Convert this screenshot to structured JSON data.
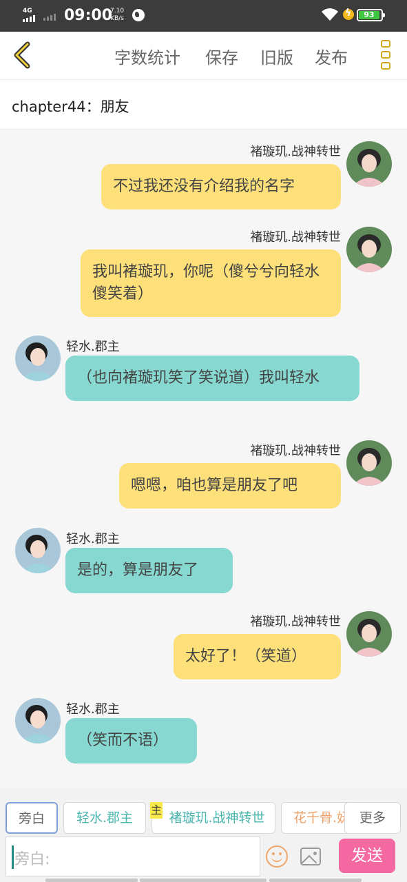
{
  "status": {
    "network": "4G",
    "time": "09:00",
    "speed_value": "7.10",
    "speed_unit": "KB/s",
    "battery": "93"
  },
  "toolbar": {
    "word_count": "字数统计",
    "save": "保存",
    "old_version": "旧版",
    "publish": "发布"
  },
  "chapter_title": "chapter44：朋友",
  "messages": [
    {
      "side": "right",
      "name": "褚璇玑.战神转世",
      "text": "不过我还没有介绍我的名字"
    },
    {
      "side": "right",
      "name": "褚璇玑.战神转世",
      "text": "我叫褚璇玑，你呢（傻兮兮向轻水傻笑着）"
    },
    {
      "side": "left",
      "name": "轻水.郡主",
      "text": "（也向褚璇玑笑了笑说道）我叫轻水"
    },
    {
      "side": "right",
      "name": "褚璇玑.战神转世",
      "text": "嗯嗯，咱也算是朋友了吧"
    },
    {
      "side": "left",
      "name": "轻水.郡主",
      "text": "是的，算是朋友了"
    },
    {
      "side": "right",
      "name": "褚璇玑.战神转世",
      "text": "太好了！（笑道）"
    },
    {
      "side": "left",
      "name": "轻水.郡主",
      "text": "（笑而不语）"
    }
  ],
  "characters": {
    "narrator": "旁白",
    "c1": "轻水.郡主",
    "main_tag": "主",
    "c2": "褚璇玑.战神转世",
    "c3": "花千骨.妩",
    "more": "更多"
  },
  "input": {
    "placeholder": "旁白:",
    "send": "发送"
  },
  "colors": {
    "bubble_right": "#fde07a",
    "bubble_left": "#86d8d0",
    "send_button": "#f569a3",
    "accent_icon": "#d4a91d"
  }
}
